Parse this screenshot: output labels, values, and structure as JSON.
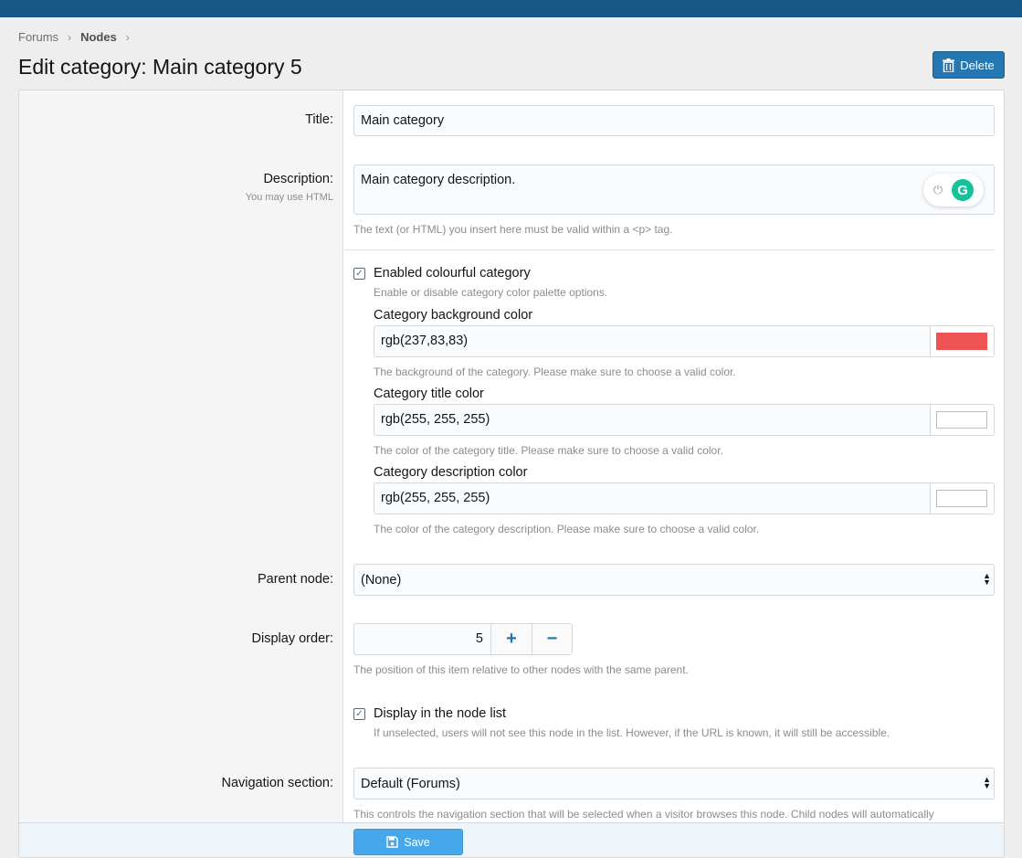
{
  "breadcrumb": {
    "items": [
      "Forums",
      "Nodes"
    ]
  },
  "page": {
    "title": "Edit category: Main category 5"
  },
  "header": {
    "delete_label": "Delete"
  },
  "form": {
    "title": {
      "label": "Title:",
      "value": "Main category"
    },
    "description": {
      "label": "Description:",
      "hint": "You may use HTML",
      "value": "Main category description.",
      "explain": "The text (or HTML) you insert here must be valid within a <p> tag."
    },
    "colourful": {
      "label": "Enabled colourful category",
      "hint": "Enable or disable category color palette options.",
      "checked": true,
      "bg": {
        "label": "Category background color",
        "value": "rgb(237,83,83)",
        "swatch": "#ed5353",
        "explain": "The background of the category. Please make sure to choose a valid color."
      },
      "title_color": {
        "label": "Category title color",
        "value": "rgb(255, 255, 255)",
        "swatch": "#ffffff",
        "explain": "The color of the category title. Please make sure to choose a valid color."
      },
      "desc_color": {
        "label": "Category description color",
        "value": "rgb(255, 255, 255)",
        "swatch": "#ffffff",
        "explain": "The color of the category description. Please make sure to choose a valid color."
      }
    },
    "parent_node": {
      "label": "Parent node:",
      "value": "(None)"
    },
    "display_order": {
      "label": "Display order:",
      "value": "5",
      "explain": "The position of this item relative to other nodes with the same parent."
    },
    "node_list": {
      "label": "Display in the node list",
      "hint": "If unselected, users will not see this node in the list. However, if the URL is known, it will still be accessible.",
      "checked": true
    },
    "navigation": {
      "label": "Navigation section:",
      "value": "Default (Forums)",
      "explain": "This controls the navigation section that will be selected when a visitor browses this node. Child nodes will automatically"
    }
  },
  "footer": {
    "save_label": "Save"
  },
  "colors": {
    "accent": "#2577b1",
    "topbar": "#185886",
    "save": "#47a7eb"
  }
}
